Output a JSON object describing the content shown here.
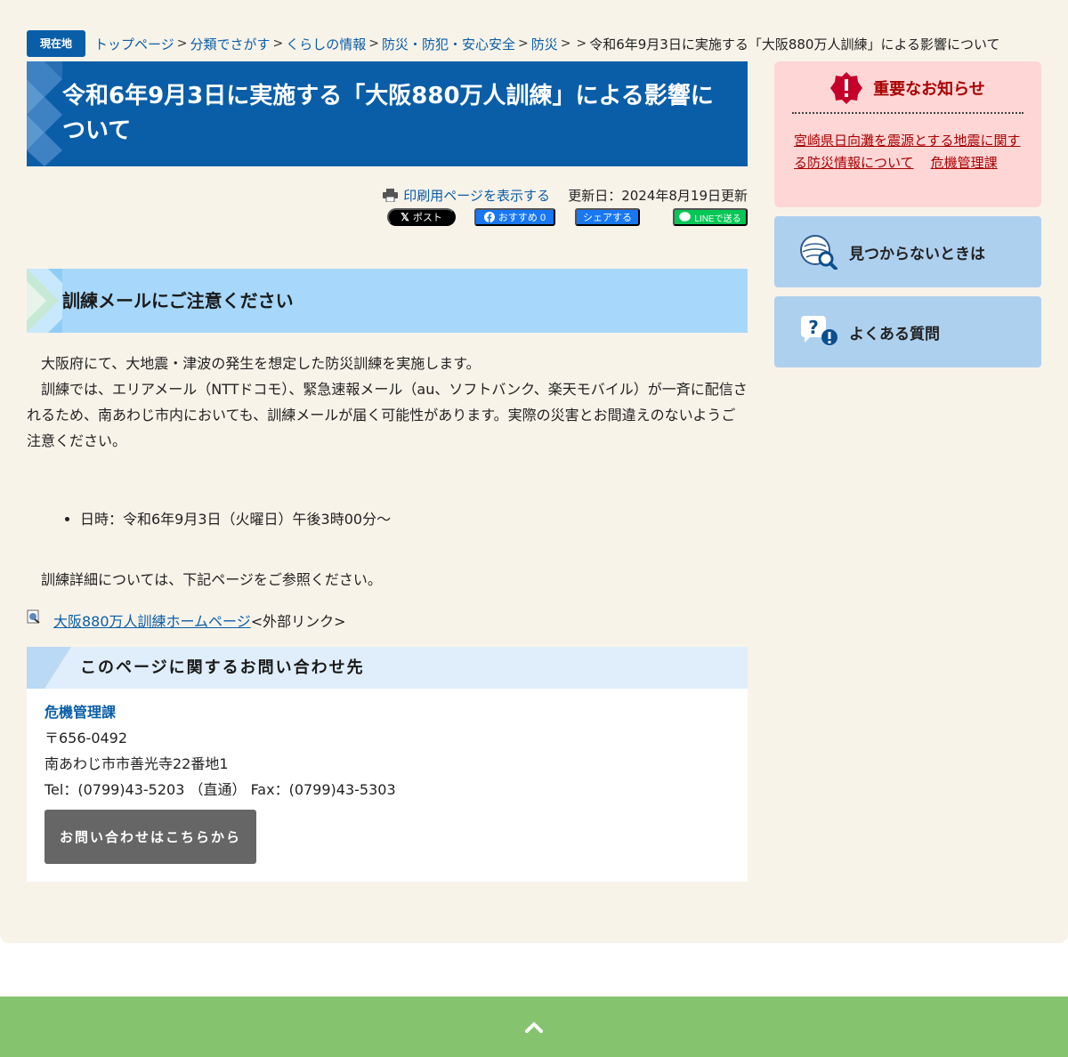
{
  "breadcrumb": {
    "badge": "現在地",
    "links": [
      "トップページ",
      "分類でさがす",
      "くらしの情報",
      "防災・防犯・安心安全",
      "防災"
    ],
    "separator": ">",
    "current": "令和6年9月3日に実施する「大阪880万人訓練」による影響について"
  },
  "page": {
    "title": "令和6年9月3日に実施する「大阪880万人訓練」による影響について",
    "print_label": "印刷用ページを表示する",
    "updated": "更新日：2024年8月19日更新"
  },
  "share": {
    "x_label": "ポスト",
    "fb_like_label": "おすすめ 0",
    "fb_share_label": "シェアする",
    "line_label": "LINEで送る"
  },
  "section": {
    "heading": "訓練メールにご注意ください",
    "para1": "大阪府にて、大地震・津波の発生を想定した防災訓練を実施します。",
    "para2": "訓練では、エリアメール（NTTドコモ）、緊急速報メール（au、ソフトバンク、楽天モバイル）が一斉に配信されるため、南あわじ市内においても、訓練メールが届く可能性があります。実際の災害とお間違えのないようご注意ください。",
    "bullet_date": "日時：令和6年9月3日（火曜日）午後3時00分～",
    "detail_para": "訓練詳細については、下記ページをご参照ください。",
    "ext_link": "大阪880万人訓練ホームページ",
    "ext_note": "<外部リンク>"
  },
  "contact": {
    "heading": "このページに関するお問い合わせ先",
    "dept": "危機管理課",
    "postal": "〒656-0492",
    "address": "南あわじ市市善光寺22番地1",
    "phone": "Tel：(0799)43-5203 （直通） Fax：(0799)43-5303",
    "button": "お問い合わせはこちらから"
  },
  "sidebar": {
    "notice_title": "重要なお知らせ",
    "notice_link": "宮崎県日向灘を震源とする地震に関する防災情報について",
    "notice_dept": "危機管理課",
    "find_label": "見つからないときは",
    "faq_label": "よくある質問"
  },
  "colors": {
    "brand_blue": "#0a5ea8",
    "page_bg": "#f8f3e9",
    "notice_red": "#a80000",
    "footer_green": "#86c36f"
  }
}
